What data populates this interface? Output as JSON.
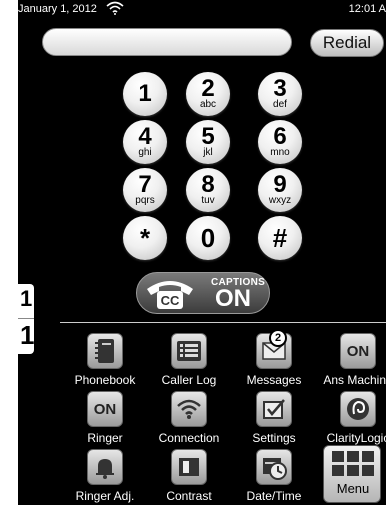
{
  "status_bar": {
    "date": "January 1, 2012",
    "time": "12:01 A"
  },
  "number_field": {
    "value": ""
  },
  "redial": {
    "label": "Redial"
  },
  "keypad": [
    {
      "digit": "1",
      "letters": ""
    },
    {
      "digit": "2",
      "letters": "abc"
    },
    {
      "digit": "3",
      "letters": "def"
    },
    {
      "digit": "4",
      "letters": "ghi"
    },
    {
      "digit": "5",
      "letters": "jkl"
    },
    {
      "digit": "6",
      "letters": "mno"
    },
    {
      "digit": "7",
      "letters": "pqrs"
    },
    {
      "digit": "8",
      "letters": "tuv"
    },
    {
      "digit": "9",
      "letters": "wxyz"
    },
    {
      "digit": "*",
      "letters": ""
    },
    {
      "digit": "0",
      "letters": ""
    },
    {
      "digit": "#",
      "letters": ""
    }
  ],
  "captions": {
    "cc": "CC",
    "title": "CAPTIONS",
    "state": "ON"
  },
  "side_tab": {
    "top": "1",
    "bottom": "1"
  },
  "apps": [
    {
      "label": "Phonebook",
      "icon": "phonebook-icon"
    },
    {
      "label": "Caller Log",
      "icon": "list-icon"
    },
    {
      "label": "Messages",
      "icon": "envelope-icon",
      "badge": "2"
    },
    {
      "label": "Ans Machine",
      "icon": "on-icon",
      "text": "ON"
    },
    {
      "label": "Ringer",
      "icon": "on-icon",
      "text": "ON"
    },
    {
      "label": "Connection",
      "icon": "wifi-icon"
    },
    {
      "label": "Settings",
      "icon": "checkbox-icon"
    },
    {
      "label": "ClarityLogic",
      "icon": "ear-icon"
    },
    {
      "label": "Ringer Adj.",
      "icon": "bell-icon"
    },
    {
      "label": "Contrast",
      "icon": "contrast-icon"
    },
    {
      "label": "Date/Time",
      "icon": "calendar-clock-icon"
    }
  ],
  "menu": {
    "label": "Menu"
  }
}
